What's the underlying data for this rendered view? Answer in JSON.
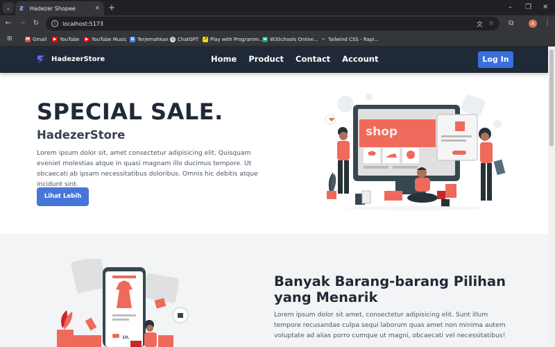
{
  "browser": {
    "tab_title": "Hadezer Shopee",
    "tab_close": "×",
    "new_tab": "+",
    "url": "localhost:5173",
    "profile_initial": "A",
    "bookmarks": [
      {
        "label": "Gmail",
        "icon": "gmail-icon",
        "color": "#ea4335"
      },
      {
        "label": "YouTube",
        "icon": "youtube-icon",
        "color": "#ff0000"
      },
      {
        "label": "YouTube Music",
        "icon": "youtube-music-icon",
        "color": "#ff0000"
      },
      {
        "label": "Terjemahkan",
        "icon": "translate-icon",
        "color": "#4285f4"
      },
      {
        "label": "ChatGPT",
        "icon": "chatgpt-icon",
        "color": "#e8eaed"
      },
      {
        "label": "Play with Programm...",
        "icon": "play-icon",
        "color": "#f5d90a"
      },
      {
        "label": "W3Schools Online...",
        "icon": "w3schools-icon",
        "color": "#04aa6d"
      },
      {
        "label": "Tailwind CSS - Rapi...",
        "icon": "tailwind-icon",
        "color": "#38bdf8"
      }
    ]
  },
  "site": {
    "brand": "HadezerStore",
    "nav": [
      "Home",
      "Product",
      "Contact",
      "Account"
    ],
    "login_label": "Log In",
    "hero": {
      "title": "SPECIAL SALE.",
      "subtitle": "HadezerStore",
      "text": "Lorem ipsum dolor sit, amet consectetur adipisicing elit. Quisquam eveniet molestias atque in quasi magnam illo ducimus tempore. Ut obcaecati ab ipsam necessitatibus doloribus. Omnis hic debitis atque incidunt sint.",
      "button": "Lihat Lebih",
      "screen_word": "shop"
    },
    "section2": {
      "title": "Banyak Barang-barang Pilihan yang Menarik",
      "text": "Lorem ipsum dolor sit amet, consectetur adipisicing elit. Sunt illum tempore recusandae culpa sequi laborum quas amet non minima autem voluptate ad alias porro cumque ut magni, obcaecati vel necessitatibus!",
      "phone_price": "10.",
      "phone_buy": "$$"
    }
  },
  "colors": {
    "navbar": "#1f2937",
    "primary_button": "#3b6fe0",
    "accent_illustration": "#ef6a5a",
    "section_bg": "#f3f4f6"
  }
}
